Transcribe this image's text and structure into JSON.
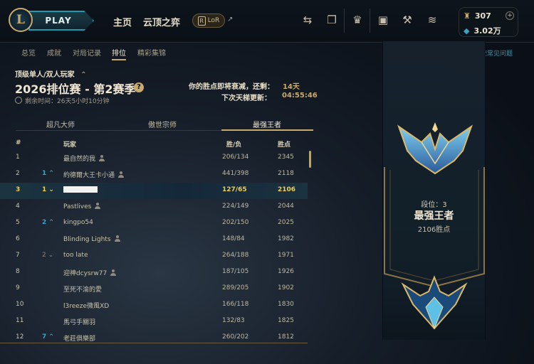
{
  "topbar": {
    "play_label": "PLAY",
    "nav": [
      "主页",
      "云顶之弈"
    ],
    "lor_label": "LoR",
    "currency": {
      "essence": "307",
      "rp": "3.02万"
    }
  },
  "subtabs": [
    "总览",
    "成就",
    "对局记录",
    "排位",
    "精彩集锦"
  ],
  "help_link": "战区系统常见问题",
  "ranked": {
    "queue": "顶级单人/双人玩家",
    "season": "2026排位赛 - 第2赛季",
    "remaining": "剩余时间：26天5小时10分钟",
    "decay_label": "你的胜点即将衰减，还剩：",
    "decay_value": "14天",
    "update_label": "下次天梯更新：",
    "update_value": "04:55:46"
  },
  "tiers": [
    "超凡大师",
    "傲世宗师",
    "最强王者"
  ],
  "table": {
    "headers": {
      "rank": "#",
      "player": "玩家",
      "winloss": "胜/负",
      "lp": "胜点"
    },
    "rows": [
      {
        "rank": "1",
        "change": "",
        "dir": "",
        "name": "最自然的我",
        "wl": "206/134",
        "lp": "2345"
      },
      {
        "rank": "2",
        "change": "1",
        "dir": "up",
        "name": "約德爾大王卡小通",
        "wl": "441/398",
        "lp": "2118"
      },
      {
        "rank": "3",
        "change": "1",
        "dir": "down",
        "name": "",
        "wl": "127/65",
        "lp": "2106"
      },
      {
        "rank": "4",
        "change": "",
        "dir": "",
        "name": "Pastlives",
        "wl": "224/149",
        "lp": "2044"
      },
      {
        "rank": "5",
        "change": "2",
        "dir": "up",
        "name": "kingpo54",
        "wl": "202/150",
        "lp": "2025"
      },
      {
        "rank": "6",
        "change": "",
        "dir": "",
        "name": "Blinding Lights",
        "wl": "148/84",
        "lp": "1982"
      },
      {
        "rank": "7",
        "change": "2",
        "dir": "down",
        "name": "too late",
        "wl": "264/188",
        "lp": "1971"
      },
      {
        "rank": "8",
        "change": "",
        "dir": "",
        "name": "迎神dcysrw77",
        "wl": "187/105",
        "lp": "1926"
      },
      {
        "rank": "9",
        "change": "",
        "dir": "",
        "name": "至死不渝的愛",
        "wl": "289/205",
        "lp": "1902"
      },
      {
        "rank": "10",
        "change": "",
        "dir": "",
        "name": "l3reeze微風XD",
        "wl": "166/118",
        "lp": "1830"
      },
      {
        "rank": "11",
        "change": "",
        "dir": "",
        "name": "馬弓手關羽",
        "wl": "132/83",
        "lp": "1825"
      },
      {
        "rank": "12",
        "change": "7",
        "dir": "up",
        "name": "老莊俱樂部",
        "wl": "260/202",
        "lp": "1812"
      }
    ]
  },
  "rank_panel": {
    "position_label": "段位：3",
    "tier": "最强王者",
    "lp": "2106胜点"
  },
  "icons": [
    "league-logo-icon",
    "trade-icon",
    "clash-icon",
    "champion-icon",
    "loot-icon",
    "crafting-icon",
    "coins-icon",
    "blue-essence-icon",
    "rp-icon"
  ],
  "colors": {
    "gold": "#c8aa6e",
    "highlight_text": "#f3cf4a",
    "teal": "#1e9bb0",
    "up_arrow": "#3aa3c6"
  }
}
